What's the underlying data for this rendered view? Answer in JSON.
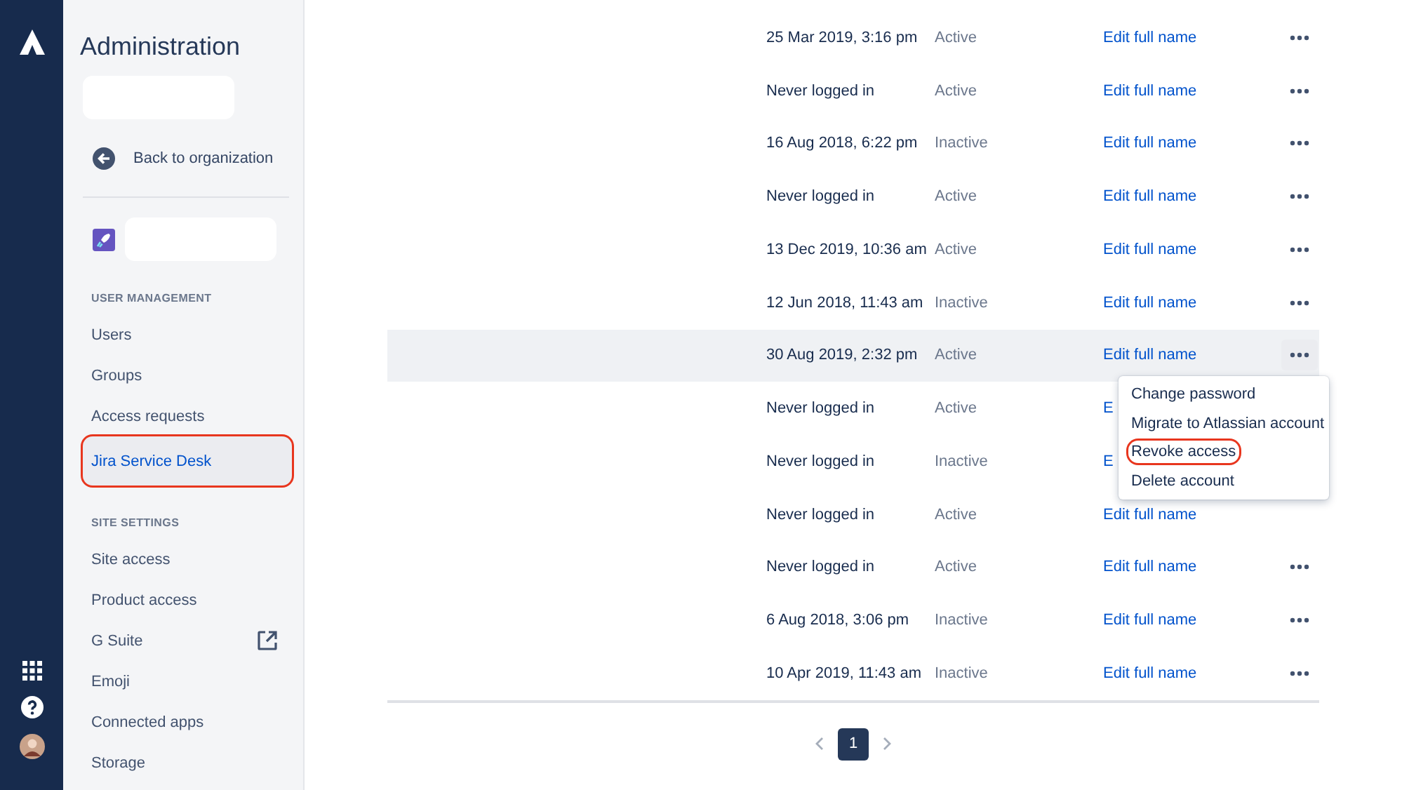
{
  "sidebar": {
    "title": "Administration",
    "back_link": "Back to organization",
    "sections": [
      {
        "heading": "USER MANAGEMENT",
        "items": [
          {
            "label": "Users",
            "selected": false,
            "circled": false,
            "external": false
          },
          {
            "label": "Groups",
            "selected": false,
            "circled": false,
            "external": false
          },
          {
            "label": "Access requests",
            "selected": false,
            "circled": false,
            "external": false
          },
          {
            "label": "Jira Service Desk",
            "selected": true,
            "circled": true,
            "external": false
          }
        ]
      },
      {
        "heading": "SITE SETTINGS",
        "items": [
          {
            "label": "Site access",
            "selected": false,
            "circled": false,
            "external": false
          },
          {
            "label": "Product access",
            "selected": false,
            "circled": false,
            "external": false
          },
          {
            "label": "G Suite",
            "selected": false,
            "circled": false,
            "external": true
          },
          {
            "label": "Emoji",
            "selected": false,
            "circled": false,
            "external": false
          },
          {
            "label": "Connected apps",
            "selected": false,
            "circled": false,
            "external": false
          },
          {
            "label": "Storage",
            "selected": false,
            "circled": false,
            "external": false
          }
        ]
      }
    ]
  },
  "table": {
    "rows": [
      {
        "last_login": "25 Mar 2019, 3:16 pm",
        "status": "Active",
        "action": "Edit full name",
        "more": true,
        "selected": false
      },
      {
        "last_login": "Never logged in",
        "status": "Active",
        "action": "Edit full name",
        "more": true,
        "selected": false
      },
      {
        "last_login": "16 Aug 2018, 6:22 pm",
        "status": "Inactive",
        "action": "Edit full name",
        "more": true,
        "selected": false
      },
      {
        "last_login": "Never logged in",
        "status": "Active",
        "action": "Edit full name",
        "more": true,
        "selected": false
      },
      {
        "last_login": "13 Dec 2019, 10:36 am",
        "status": "Active",
        "action": "Edit full name",
        "more": true,
        "selected": false
      },
      {
        "last_login": "12 Jun 2018, 11:43 am",
        "status": "Inactive",
        "action": "Edit full name",
        "more": true,
        "selected": false
      },
      {
        "last_login": "30 Aug 2019, 2:32 pm",
        "status": "Active",
        "action": "Edit full name",
        "more": true,
        "selected": true
      },
      {
        "last_login": "Never logged in",
        "status": "Active",
        "action": "E",
        "more": false,
        "selected": false
      },
      {
        "last_login": "Never logged in",
        "status": "Inactive",
        "action": "E",
        "more": false,
        "selected": false
      },
      {
        "last_login": "Never logged in",
        "status": "Active",
        "action": "Edit full name",
        "more": false,
        "selected": false
      },
      {
        "last_login": "Never logged in",
        "status": "Active",
        "action": "Edit full name",
        "more": true,
        "selected": false
      },
      {
        "last_login": "6 Aug 2018, 3:06 pm",
        "status": "Inactive",
        "action": "Edit full name",
        "more": true,
        "selected": false
      },
      {
        "last_login": "10 Apr 2019, 11:43 am",
        "status": "Inactive",
        "action": "Edit full name",
        "more": true,
        "selected": false
      }
    ]
  },
  "menu": {
    "items": [
      {
        "label": "Change password",
        "circled": false
      },
      {
        "label": "Migrate to Atlassian account",
        "circled": false
      },
      {
        "label": "Revoke access",
        "circled": true
      },
      {
        "label": "Delete account",
        "circled": false
      }
    ]
  },
  "pagination": {
    "pages": [
      {
        "label": "1",
        "selected": true
      }
    ]
  }
}
